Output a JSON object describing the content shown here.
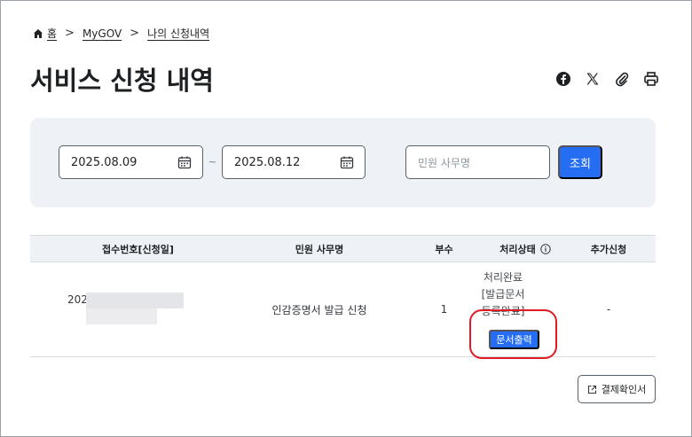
{
  "breadcrumb": {
    "items": [
      "홈",
      "MyGOV",
      "나의 신청내역"
    ],
    "separator": ">"
  },
  "page": {
    "title": "서비스 신청 내역"
  },
  "share_icons": [
    "facebook-icon",
    "x-icon",
    "paperclip-icon",
    "printer-icon"
  ],
  "search": {
    "start_date": "2025.08.09",
    "end_date": "2025.08.12",
    "range_separator": "~",
    "name_placeholder": "민원 사무명",
    "search_label": "조회"
  },
  "table": {
    "headers": [
      "접수번호[신청일]",
      "민원 사무명",
      "부수",
      "처리상태",
      "추가신청"
    ],
    "rows": [
      {
        "receipt_no": "202",
        "name": "인감증명서 발급 신청",
        "copies": "1",
        "status_line1": "처리완료",
        "status_line2": "[발급문서",
        "status_line3": "등록완료]",
        "action_label": "문서출력",
        "extra": "-"
      }
    ]
  },
  "footer": {
    "receipt_button": "결제확인서"
  },
  "colors": {
    "primary": "#256ef4",
    "highlight_ring": "#e01b24",
    "panel_bg": "#eef2f7"
  }
}
